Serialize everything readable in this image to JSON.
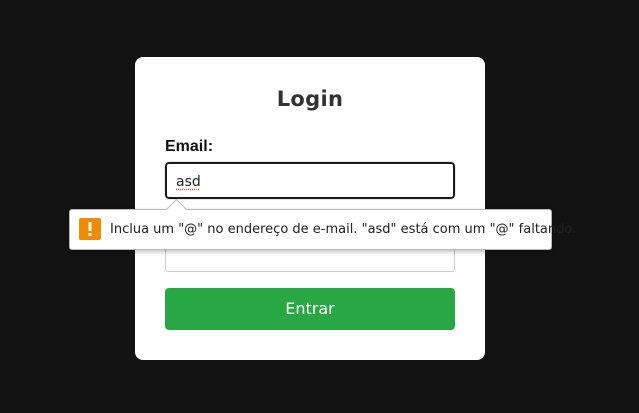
{
  "login": {
    "title": "Login",
    "email_label": "Email:",
    "email_value": "asd",
    "submit_label": "Entrar"
  },
  "validation": {
    "message": "Inclua um \"@\" no endereço de e-mail. \"asd\" está com um \"@\" faltando.",
    "icon": "warning-icon",
    "icon_color": "#f08a00"
  },
  "colors": {
    "background": "#131313",
    "button": "#28a745"
  }
}
